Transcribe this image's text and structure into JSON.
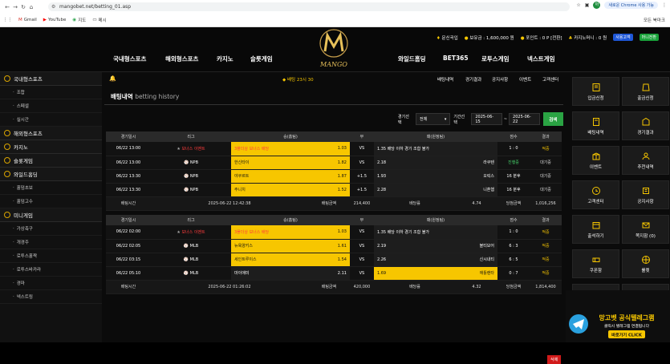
{
  "browser": {
    "url": "mangobet.net/betting_01.asp",
    "restart": "새로운 Chrome 사용 가능",
    "bookmarks": [
      "Gmail",
      "YouTube",
      "지도",
      "메시"
    ],
    "all_bookmarks": "모든 북마크",
    "avatar": "아"
  },
  "header": {
    "links": [
      {
        "label": "문신곡입"
      },
      {
        "label": "보유금 : 1,600,000 원"
      },
      {
        "label": "포인트 : 0 P [전환]"
      },
      {
        "label": "카지노머니 : 0 원"
      }
    ],
    "btn_blue": "사용고객",
    "btn_green": "머니전환",
    "logo_text": "MANGO",
    "nav": [
      "국내형스포츠",
      "해외형스포츠",
      "카지노",
      "슬롯게임",
      "와일드홈딩",
      "BET365",
      "로투스게임",
      "넥스트게임"
    ]
  },
  "sidebar": [
    {
      "type": "head",
      "label": "국내형스포츠"
    },
    {
      "type": "item",
      "label": "조합"
    },
    {
      "type": "item",
      "label": "스페셜"
    },
    {
      "type": "item",
      "label": "실시간"
    },
    {
      "type": "head",
      "label": "해외형스포츠"
    },
    {
      "type": "head",
      "label": "카지노"
    },
    {
      "type": "head",
      "label": "슬롯게임"
    },
    {
      "type": "head",
      "label": "와일드홈딩"
    },
    {
      "type": "item",
      "label": "홀덤초보"
    },
    {
      "type": "item",
      "label": "홀덤고수"
    },
    {
      "type": "head",
      "label": "미니게임"
    },
    {
      "type": "item",
      "label": "가상축구"
    },
    {
      "type": "item",
      "label": "개경주"
    },
    {
      "type": "item",
      "label": "로투스홀짝"
    },
    {
      "type": "item",
      "label": "로투스바카라"
    },
    {
      "type": "item",
      "label": "경마"
    },
    {
      "type": "item",
      "label": "넥스트링"
    }
  ],
  "subnav": {
    "notice": "◆ 배팅 23시 30",
    "links": [
      "배팅내역",
      "경기결과",
      "공지사항",
      "이벤트",
      "고객센터"
    ]
  },
  "page": {
    "title": "배팅내역",
    "subtitle": "betting history"
  },
  "filter": {
    "label1": "경기선택",
    "select": "전체",
    "label2": "기간선택",
    "from": "2025-06-15",
    "to": "2025-06-22",
    "search": "검색"
  },
  "table_headers": [
    "경기일시",
    "리그",
    "승(홈팀)",
    "무",
    "패(원정팀)",
    "점수",
    "결과"
  ],
  "bet1": {
    "rows": [
      {
        "date": "06/22 13:00",
        "league": "보너스 이벤트",
        "home": "3폴더상 보너스 배당",
        "hodd": "1.03",
        "draw": "VS",
        "away": "1.35 배당 이하 경기 조합 불가",
        "aodd": "",
        "score": "1 : 0",
        "result": "적중",
        "hy": true,
        "ay": false,
        "red": true,
        "flag": "★"
      },
      {
        "date": "06/22 13:00",
        "league": "NPB",
        "home": "한신타이",
        "hodd": "1.82",
        "draw": "VS",
        "away": "2.18",
        "aodd": "라쿠텐",
        "score": "진행중",
        "result": "대기중",
        "hy": true,
        "ay": false,
        "red": false,
        "flag": "⚾"
      },
      {
        "date": "06/22 13:30",
        "league": "NPB",
        "home": "야쿠르트",
        "hodd": "1.87",
        "draw": "+1.5",
        "away": "1.93",
        "aodd": "오릭스",
        "score": "16 분후",
        "result": "대기중",
        "hy": true,
        "ay": false,
        "red": false,
        "flag": "⚾"
      },
      {
        "date": "06/22 13:30",
        "league": "NPB",
        "home": "주니치",
        "hodd": "1.52",
        "draw": "+1.5",
        "away": "2.28",
        "aodd": "니혼햄",
        "score": "16 분후",
        "result": "대기중",
        "hy": true,
        "ay": false,
        "red": false,
        "flag": "⚾"
      }
    ],
    "summary": {
      "l1": "배팅시간",
      "v1": "2025-06-22 12:42:38",
      "l2": "배팅금액",
      "v2": "214,400",
      "l3": "배당률",
      "v3": "4.74",
      "l4": "당첨금액",
      "v4": "1,016,256"
    }
  },
  "bet2": {
    "rows": [
      {
        "date": "06/22 02:00",
        "league": "보너스 이벤트",
        "home": "3폴더상 보너스 배당",
        "hodd": "1.03",
        "draw": "VS",
        "away": "1.35 배당 이하 경기 조합 불가",
        "aodd": "",
        "score": "1 : 0",
        "result": "적중",
        "hy": true,
        "ay": false,
        "red": true,
        "flag": "★"
      },
      {
        "date": "06/22 02:05",
        "league": "MLB",
        "home": "뉴욕양키스",
        "hodd": "1.61",
        "draw": "VS",
        "away": "2.19",
        "aodd": "볼티모어",
        "score": "6 : 3",
        "result": "적중",
        "hy": true,
        "ay": false,
        "red": false,
        "flag": "⚾"
      },
      {
        "date": "06/22 03:15",
        "league": "MLB",
        "home": "세인트루이스",
        "hodd": "1.54",
        "draw": "VS",
        "away": "2.26",
        "aodd": "신시내티",
        "score": "6 : 5",
        "result": "적중",
        "hy": true,
        "ay": false,
        "red": false,
        "flag": "⚾"
      },
      {
        "date": "06/22 05:10",
        "league": "MLB",
        "home": "마이애미",
        "hodd": "2.11",
        "draw": "VS",
        "away": "1.69",
        "aodd": "애틀랜타",
        "score": "0 : 7",
        "result": "적중",
        "hy": false,
        "ay": true,
        "red": false,
        "flag": "⚾"
      }
    ],
    "summary": {
      "l1": "배팅시간",
      "v1": "2025-06-22 01:26:02",
      "l2": "배팅금액",
      "v2": "420,000",
      "l3": "배당률",
      "v3": "4.32",
      "l4": "당첨금액",
      "v4": "1,814,400"
    }
  },
  "delete": "삭제",
  "tiles": [
    "입금신청",
    "출금신청",
    "배팅내역",
    "경기결과",
    "이벤트",
    "추천내역",
    "고객센터",
    "공지사항",
    "출석하기",
    "쪽지함 (0)",
    "쿠폰함",
    "룰렛",
    "마이페이지",
    "로그아웃"
  ],
  "promo": {
    "title": "망고벳 공식텔레그램",
    "sub": "클릭시 텔레그램 연결됩니다",
    "btn": "바로가기 CLICK"
  }
}
